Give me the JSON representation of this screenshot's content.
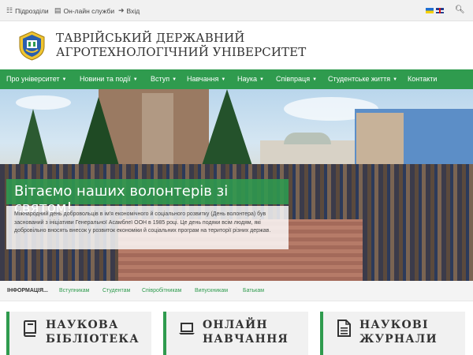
{
  "topbar": {
    "links": [
      {
        "label": "Підрозділи",
        "icon": "sitemap-icon"
      },
      {
        "label": "Он-лайн служби",
        "icon": "monitor-icon"
      },
      {
        "label": "Вхід",
        "icon": "login-icon"
      }
    ],
    "languages": [
      "ua",
      "en"
    ]
  },
  "header": {
    "line1": "ТАВРІЙСЬКИЙ ДЕРЖАВНИЙ",
    "line2": "АГРОТЕХНОЛОГІЧНИЙ УНІВЕРСИТЕТ"
  },
  "nav": {
    "items": [
      {
        "label": "Про університет",
        "has_menu": true
      },
      {
        "label": "Новини та події",
        "has_menu": true
      },
      {
        "label": "Вступ",
        "has_menu": true
      },
      {
        "label": "Навчання",
        "has_menu": true
      },
      {
        "label": "Наука",
        "has_menu": true
      },
      {
        "label": "Співпраця",
        "has_menu": true
      },
      {
        "label": "Студентське життя",
        "has_menu": true
      },
      {
        "label": "Контакти",
        "has_menu": false
      }
    ]
  },
  "hero": {
    "title": "Вітаємо наших волонтерів зі святом!",
    "text": "Міжнародний день добровольців в ім'я економічного й соціального розвитку (День волонтера) був заснований з ініціативи Генеральної Асамблеї ООН в 1985 році. Це день подяки всім людям, які добровільно вносять внесок у розвиток економіки й соціальних програм на території різних держав."
  },
  "infobar": {
    "label": "ІНФОРМАЦІЯ...",
    "links": [
      "Вступникам",
      "Студентам",
      "Співробітникам",
      "Випускникам",
      "Батькам"
    ]
  },
  "cards": [
    {
      "line1": "НАУКОВА",
      "line2": "БІБЛІОТЕКА",
      "icon": "book-icon"
    },
    {
      "line1": "ОНЛАЙН",
      "line2": "НАВЧАННЯ",
      "icon": "laptop-icon"
    },
    {
      "line1": "НАУКОВІ",
      "line2": "ЖУРНАЛИ",
      "icon": "document-icon"
    }
  ],
  "colors": {
    "accent": "#2f9b4e",
    "topbar": "#f1f1f1",
    "card_bg": "#f1f1f1"
  }
}
